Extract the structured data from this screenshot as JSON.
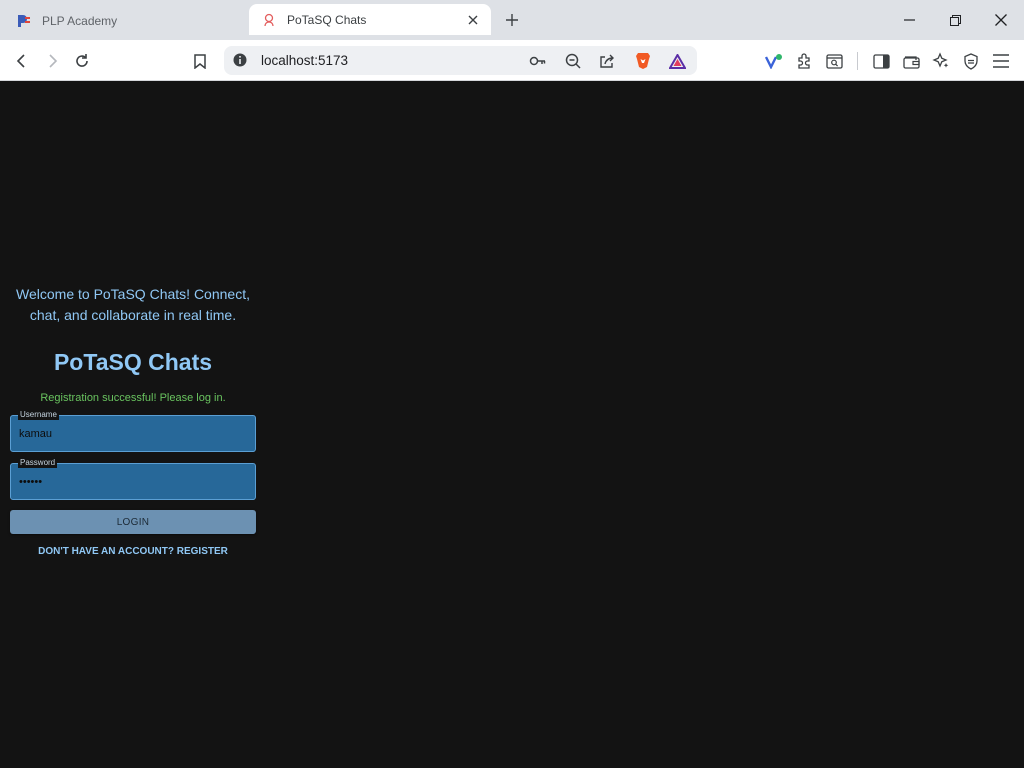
{
  "browser": {
    "tabs": [
      {
        "title": "PLP Academy",
        "active": false
      },
      {
        "title": "PoTaSQ Chats",
        "active": true
      }
    ],
    "address": "localhost:5173"
  },
  "login": {
    "welcome_line1": "Welcome to PoTaSQ Chats! Connect,",
    "welcome_line2": "chat, and collaborate in real time.",
    "title": "PoTaSQ Chats",
    "success_message": "Registration successful! Please log in.",
    "username_label": "Username",
    "username_value": "kamau",
    "password_label": "Password",
    "password_value": "••••••",
    "login_button": "LOGIN",
    "register_link": "DON'T HAVE AN ACCOUNT? REGISTER"
  },
  "colors": {
    "page_background": "#131313",
    "accent_text": "#90c8f5",
    "success_text": "#69c35f",
    "field_fill": "#276899",
    "button_fill": "#6c91b2"
  }
}
